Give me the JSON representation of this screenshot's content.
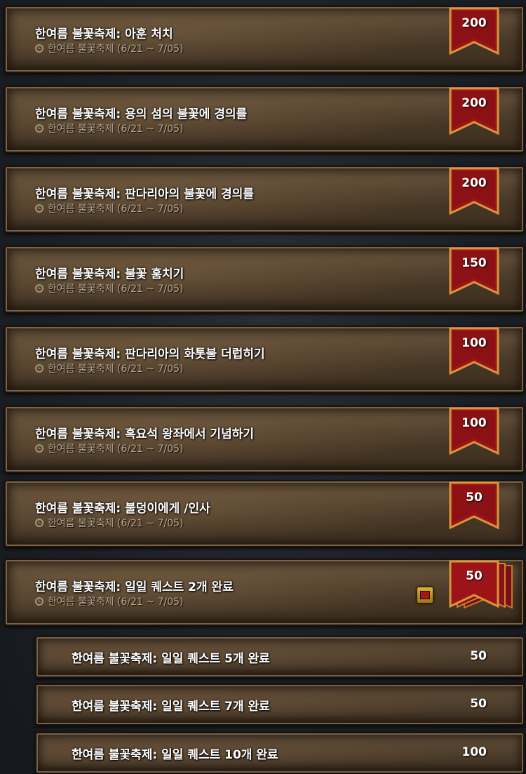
{
  "achievements": [
    {
      "title": "한여름 불꽃축제: 아훈 처치",
      "date": "한여름 불꽃축제 (6/21 ~ 7/05)",
      "points": "200"
    },
    {
      "title": "한여름 불꽃축제: 용의 섬의 불꽃에 경의를",
      "date": "한여름 불꽃축제 (6/21 ~ 7/05)",
      "points": "200"
    },
    {
      "title": "한여름 불꽃축제: 판다리아의 불꽃에 경의를",
      "date": "한여름 불꽃축제 (6/21 ~ 7/05)",
      "points": "200"
    },
    {
      "title": "한여름 불꽃축제: 불꽃 훔치기",
      "date": "한여름 불꽃축제 (6/21 ~ 7/05)",
      "points": "150"
    },
    {
      "title": "한여름 불꽃축제: 판다리아의 화톳불 더럽히기",
      "date": "한여름 불꽃축제 (6/21 ~ 7/05)",
      "points": "100"
    },
    {
      "title": "한여름 불꽃축제: 흑요석 왕좌에서 기념하기",
      "date": "한여름 불꽃축제 (6/21 ~ 7/05)",
      "points": "100"
    },
    {
      "title": "한여름 불꽃축제: 불덩이에게 /인사",
      "date": "한여름 불꽃축제 (6/21 ~ 7/05)",
      "points": "50"
    },
    {
      "title": "한여름 불꽃축제: 일일 퀘스트 2개 완료",
      "date": "한여름 불꽃축제 (6/21 ~ 7/05)",
      "points": "50"
    }
  ],
  "sub_achievements": [
    {
      "title": "한여름 불꽃축제: 일일 퀘스트 5개 완료",
      "points": "50"
    },
    {
      "title": "한여름 불꽃축제: 일일 퀘스트 7개 완료",
      "points": "50"
    },
    {
      "title": "한여름 불꽃축제: 일일 퀘스트 10개 완료",
      "points": "100"
    }
  ],
  "icons": {
    "date": "clock-icon",
    "points": "banner-icon",
    "tracker": "tracking-checkbox-icon"
  },
  "colors": {
    "banner_red": "#a8161a",
    "banner_border": "#e0a040",
    "date_text": "#b9a98e",
    "title_text": "#ffffff"
  }
}
